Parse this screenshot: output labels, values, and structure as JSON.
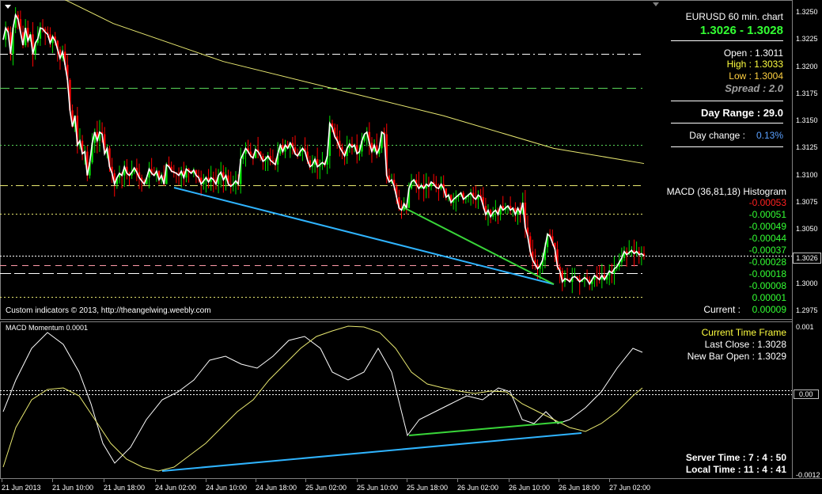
{
  "window": {
    "menu_glyph": "▼"
  },
  "chart_data": [
    {
      "type": "candlestick",
      "title": "EURUSD 60 min. chart",
      "ylim": [
        1.2975,
        1.325
      ],
      "y_ticks": [
        "1.3250",
        "1.3225",
        "1.3200",
        "1.3175",
        "1.3150",
        "1.3125",
        "1.3100",
        "1.3075",
        "1.3050",
        "1.3025",
        "1.3000",
        "1.2975"
      ],
      "x_ticks": [
        "21 Jun 2013",
        "21 Jun 10:00",
        "21 Jun 18:00",
        "24 Jun 02:00",
        "24 Jun 10:00",
        "24 Jun 18:00",
        "25 Jun 02:00",
        "25 Jun 10:00",
        "25 Jun 18:00",
        "26 Jun 02:00",
        "26 Jun 10:00",
        "26 Jun 18:00",
        "27 Jun 02:00"
      ],
      "current_price": "1.3026",
      "levels": [
        1.3212,
        1.3181,
        1.3128,
        1.3091,
        1.3065,
        1.3026,
        1.3017,
        1.301,
        1.2988
      ],
      "moving_average": [
        [
          0,
          1.329
        ],
        [
          50,
          1.324
        ],
        [
          100,
          1.3205
        ],
        [
          150,
          1.318
        ],
        [
          200,
          1.3155
        ],
        [
          250,
          1.3125
        ],
        [
          291,
          1.3111
        ]
      ],
      "closes": [
        1.3225,
        1.3236,
        1.3232,
        1.3212,
        1.3236,
        1.3248,
        1.3244,
        1.3232,
        1.322,
        1.3236,
        1.3224,
        1.323,
        1.3212,
        1.3222,
        1.3226,
        1.3236,
        1.3235,
        1.3232,
        1.323,
        1.3222,
        1.3228,
        1.3224,
        1.3216,
        1.3208,
        1.3214,
        1.3202,
        1.3188,
        1.316,
        1.3145,
        1.3155,
        1.3128,
        1.3132,
        1.312,
        1.3122,
        1.31,
        1.3112,
        1.313,
        1.314,
        1.3132,
        1.314,
        1.3138,
        1.312,
        1.3125,
        1.3108,
        1.3102,
        1.3092,
        1.3098,
        1.3102,
        1.31,
        1.3108,
        1.3102,
        1.31,
        1.3103,
        1.3107,
        1.3103,
        1.3098,
        1.3095,
        1.3092,
        1.3098,
        1.3106,
        1.3102,
        1.31,
        1.3104,
        1.3096,
        1.31,
        1.3092,
        1.311,
        1.3108,
        1.3104,
        1.3103,
        1.3102,
        1.31,
        1.3104,
        1.3098,
        1.3106,
        1.3104,
        1.3102,
        1.3105,
        1.31,
        1.3098,
        1.3092,
        1.3095,
        1.3098,
        1.3094,
        1.3098,
        1.3096,
        1.3092,
        1.31,
        1.3103,
        1.3096,
        1.31,
        1.3092,
        1.309,
        1.3092,
        1.3095,
        1.3092,
        1.3115,
        1.312,
        1.3125,
        1.3122,
        1.3118,
        1.3116,
        1.3124,
        1.3122,
        1.3118,
        1.3113,
        1.3115,
        1.3118,
        1.3114,
        1.3112,
        1.311,
        1.312,
        1.3128,
        1.3122,
        1.3128,
        1.3125,
        1.313,
        1.3126,
        1.312,
        1.3118,
        1.3122,
        1.3125,
        1.3122,
        1.3114,
        1.3108,
        1.311,
        1.3115,
        1.3108,
        1.311,
        1.3112,
        1.311,
        1.3118,
        1.3148,
        1.3144,
        1.3136,
        1.3132,
        1.3126,
        1.3122,
        1.3118,
        1.3125,
        1.3129,
        1.3126,
        1.3128,
        1.312,
        1.3122,
        1.3132,
        1.3138,
        1.314,
        1.313,
        1.3122,
        1.3128,
        1.312,
        1.3125,
        1.314,
        1.3138,
        1.31,
        1.3094,
        1.3096,
        1.309,
        1.308,
        1.307,
        1.3068,
        1.3074,
        1.307,
        1.3088,
        1.3094,
        1.3096,
        1.3092,
        1.3088,
        1.3091,
        1.3088,
        1.3092,
        1.309,
        1.3094,
        1.3092,
        1.3089,
        1.3088,
        1.3092,
        1.3088,
        1.308,
        1.3082,
        1.3075,
        1.3078,
        1.308,
        1.3082,
        1.3084,
        1.3078,
        1.308,
        1.3082,
        1.3084,
        1.308,
        1.3078,
        1.3082,
        1.308,
        1.3072,
        1.3064,
        1.3068,
        1.3062,
        1.3066,
        1.3068,
        1.3064,
        1.3072,
        1.3068,
        1.307,
        1.3072,
        1.3068,
        1.307,
        1.3064,
        1.307,
        1.3065,
        1.3075,
        1.3052,
        1.3044,
        1.303,
        1.3022,
        1.3018,
        1.3014,
        1.3017,
        1.3022,
        1.3034,
        1.3046,
        1.3044,
        1.3038,
        1.3032,
        1.3016,
        1.3012,
        1.3002,
        1.3005,
        1.3004,
        1.3002,
        1.3006,
        1.3007,
        1.3005,
        1.3002,
        1.3004,
        1.3006,
        1.3004,
        1.3,
        1.3004,
        1.3008,
        1.3006,
        1.3004,
        1.3008,
        1.3004,
        1.3008,
        1.3012,
        1.301,
        1.3014,
        1.3016,
        1.302,
        1.3024,
        1.303,
        1.3027,
        1.3029,
        1.3031,
        1.3028,
        1.303,
        1.3027,
        1.3028,
        1.3026
      ]
    },
    {
      "type": "line",
      "title": "MACD Momentum 0.0001",
      "ylim": [
        -0.0012,
        0.001
      ],
      "y_ticks": [
        "0.001",
        "0.00",
        "-0.0012"
      ],
      "zero_line": 0.0
    }
  ],
  "indicators": {
    "symbol_title": "EURUSD 60 min. chart",
    "bid_ask": "1.3026 - 1.3028",
    "open": "Open : 1.3011",
    "high": "High : 1.3033",
    "low": "Low : 1.3004",
    "spread": "Spread : 2.0",
    "day_range": "Day Range : 29.0",
    "day_change_label": "Day change :",
    "day_change_value": "0.13%",
    "macd_title": "MACD (36,81,18) Histogram",
    "macd_values": [
      {
        "v": "-0.00053",
        "color": "#ff2020"
      },
      {
        "v": "-0.00051",
        "color": "#33ff33"
      },
      {
        "v": "-0.00049",
        "color": "#33ff33"
      },
      {
        "v": "-0.00044",
        "color": "#33ff33"
      },
      {
        "v": "-0.00037",
        "color": "#33ff33"
      },
      {
        "v": "-0.00028",
        "color": "#33ff33"
      },
      {
        "v": "-0.00018",
        "color": "#33ff33"
      },
      {
        "v": "-0.00008",
        "color": "#33ff33"
      },
      {
        "v": "0.00001",
        "color": "#33ff33"
      }
    ],
    "current_label": "Current :",
    "current_value": "0.00009",
    "credit": "Custom indicators © 2013, http://theangelwing.weebly.com"
  },
  "lower_panel": {
    "title": "MACD Momentum 0.0001",
    "time_frame_label": "Current Time Frame",
    "last_close": "Last Close : 1.3028",
    "new_bar_open": "New Bar Open : 1.3029",
    "server_time": "Server Time : 7 : 4 : 50",
    "local_time": "Local Time : 11 : 4 : 41"
  },
  "colors": {
    "bull": "#00e000",
    "bear": "#ff0000",
    "close_line": "#ffffff",
    "ma": "#e8e870",
    "blue_trend": "#2fb4ff",
    "green_trend": "#39d639",
    "level_white": "#ffffff",
    "level_yellow": "#e8e870",
    "level_green": "#59d659",
    "level_pink": "#ff9aa8",
    "macd_main": "#ffffff",
    "macd_signal": "#e8e870",
    "title_green": "#33ff33",
    "high_yellow": "#ffff40",
    "low_yellow": "#ffd040",
    "spread_grey": "#a0a0a0",
    "change_blue": "#5aa0ff"
  }
}
